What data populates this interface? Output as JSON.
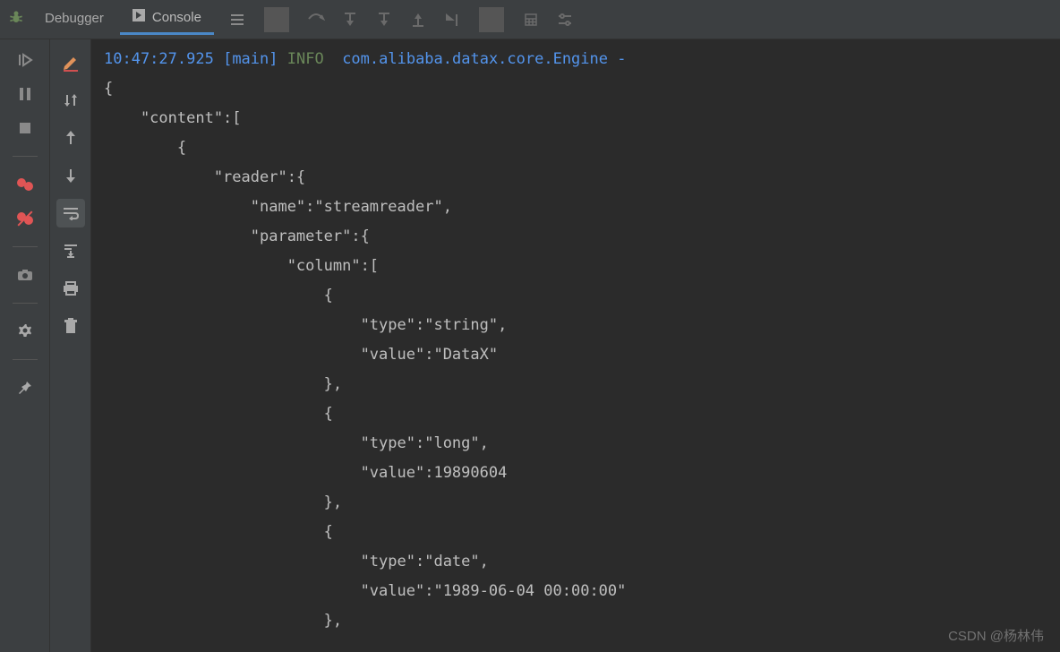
{
  "tabs": {
    "debugger": "Debugger",
    "console": "Console",
    "activeIndex": 1
  },
  "watermark": "CSDN @杨林伟",
  "log": {
    "timestamp": "10:47:27.925",
    "thread": "[main]",
    "level": "INFO",
    "class": "com.alibaba.datax.core.Engine",
    "dash": "-"
  },
  "json_lines": [
    "{",
    "    \"content\":[",
    "        {",
    "            \"reader\":{",
    "                \"name\":\"streamreader\",",
    "                \"parameter\":{",
    "                    \"column\":[",
    "                        {",
    "                            \"type\":\"string\",",
    "                            \"value\":\"DataX\"",
    "                        },",
    "                        {",
    "                            \"type\":\"long\",",
    "                            \"value\":19890604",
    "                        },",
    "                        {",
    "                            \"type\":\"date\",",
    "                            \"value\":\"1989-06-04 00:00:00\"",
    "                        },"
  ]
}
